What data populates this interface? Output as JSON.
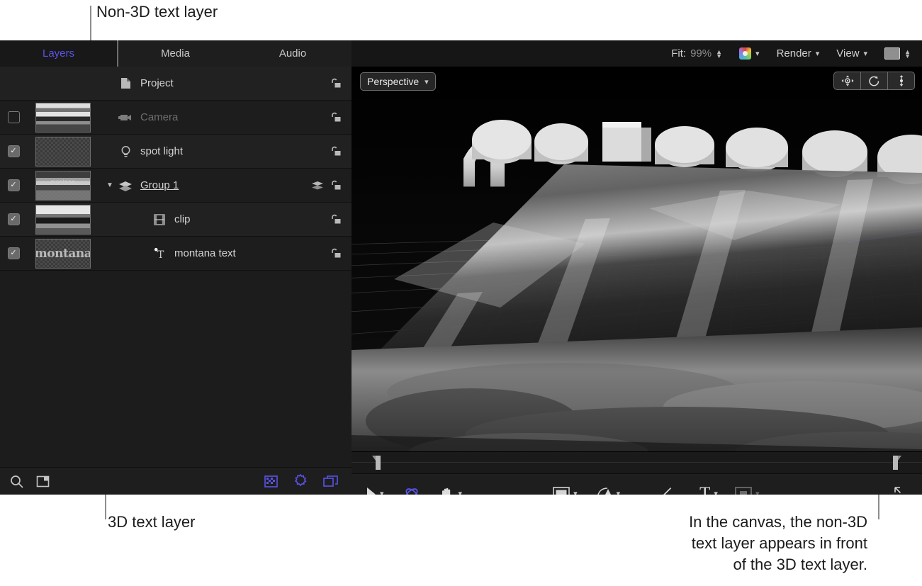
{
  "annotations": {
    "top": "Non-3D text layer",
    "bottom_left": "3D text layer",
    "bottom_right": "In the canvas, the non-3D\ntext layer appears in front\nof the 3D text layer."
  },
  "accent_color": "#5a53e8",
  "tabs": [
    {
      "label": "Layers",
      "active": true
    },
    {
      "label": "Media",
      "active": false
    },
    {
      "label": "Audio",
      "active": false
    }
  ],
  "layers": [
    {
      "name": "Project",
      "icon": "document-icon",
      "checkbox": "none",
      "thumb": "none",
      "indent": 0,
      "enabled": true,
      "lock": "unlocked-icon"
    },
    {
      "name": "Camera",
      "icon": "camera-icon",
      "checkbox": "unchecked",
      "thumb": "landscape",
      "indent": 0,
      "enabled": false,
      "lock": "unlocked-icon"
    },
    {
      "name": "spot light",
      "icon": "light-icon",
      "checkbox": "checked",
      "thumb": "empty",
      "indent": 0,
      "enabled": true,
      "lock": "unlocked-icon"
    },
    {
      "name": "Group 1",
      "icon": "group-icon",
      "checkbox": "checked",
      "thumb": "group",
      "indent": 0,
      "enabled": true,
      "lock": "unlocked-icon",
      "disclosure": "expanded",
      "extra_icon": "layers-stack-icon",
      "underlined": true
    },
    {
      "name": "clip",
      "icon": "film-icon",
      "checkbox": "checked",
      "thumb": "clip",
      "indent": 1,
      "enabled": true,
      "lock": "unlocked-icon"
    },
    {
      "name": "montana text",
      "icon": "text-3d-icon",
      "checkbox": "checked",
      "thumb": "montana",
      "indent": 1,
      "enabled": true,
      "lock": "unlocked-icon"
    }
  ],
  "thumb_text": "montana",
  "thumb_ghost_group": "montana",
  "layers_footer": {
    "left_icons": [
      "search-icon",
      "new-layer-icon"
    ],
    "right_icons": [
      "mask-icon",
      "behavior-icon",
      "filter-icon"
    ]
  },
  "viewer_toolbar": {
    "fit_label": "Fit:",
    "fit_value": "99%",
    "color_icon": "color-wheel-icon",
    "render_label": "Render",
    "view_label": "View",
    "display_icon": "render-quality-icon"
  },
  "canvas": {
    "camera_preset": "Perspective",
    "view3d_buttons": [
      "pan-camera-icon",
      "orbit-camera-icon",
      "dolly-camera-icon"
    ],
    "timeline_in_marker": "in-point-marker",
    "timeline_out_marker": "out-point-marker"
  },
  "tools": [
    {
      "name": "select-tool",
      "glyph": "arrow",
      "chevron": true,
      "active": false
    },
    {
      "name": "3d-transform-tool",
      "glyph": "orbit",
      "chevron": false,
      "active": true
    },
    {
      "name": "pan-tool",
      "glyph": "hand",
      "chevron": true,
      "active": false
    },
    {
      "name": "shape-tool",
      "glyph": "rect",
      "chevron": true,
      "active": false
    },
    {
      "name": "bezier-tool",
      "glyph": "pen",
      "chevron": true,
      "active": false
    },
    {
      "name": "paint-tool",
      "glyph": "brush",
      "chevron": false,
      "active": false
    },
    {
      "name": "text-tool",
      "glyph": "T",
      "chevron": true,
      "active": false
    },
    {
      "name": "mask-tool",
      "glyph": "mask",
      "chevron": true,
      "active": false,
      "disabled": true
    },
    {
      "name": "resize-handle",
      "glyph": "resize",
      "chevron": false,
      "active": false
    }
  ]
}
